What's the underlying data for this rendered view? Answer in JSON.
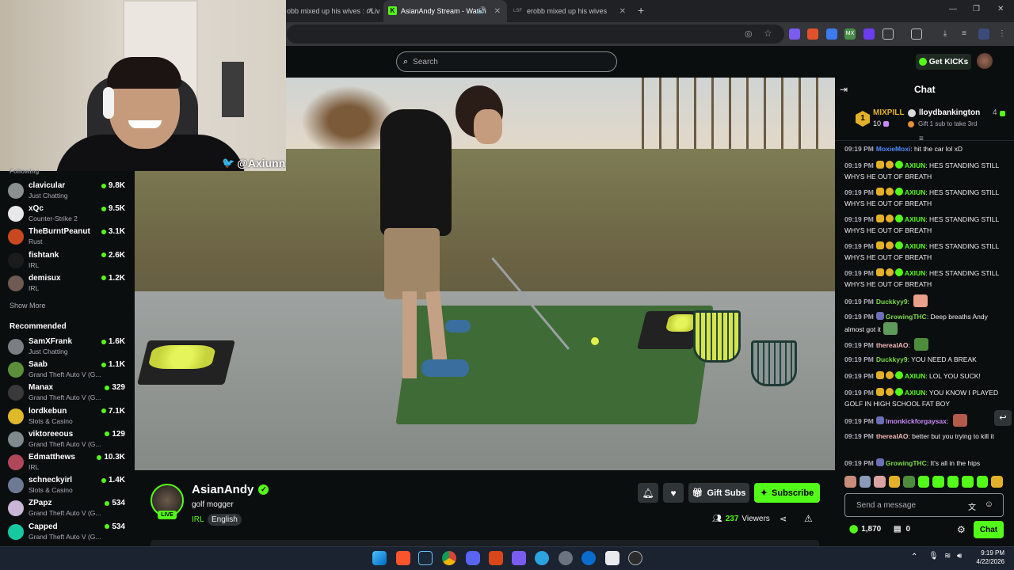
{
  "browser": {
    "tabs": [
      {
        "title": "obb mixed up his wives : r/Liv"
      },
      {
        "title": "AsianAndy Stream - Watch"
      },
      {
        "title": "erobb mixed up his wives",
        "prefix": "LSF"
      }
    ],
    "new_tab": "+",
    "window_min": "—",
    "window_restore": "❐",
    "window_close": "✕"
  },
  "header": {
    "search_placeholder": "Search",
    "get_kicks_label": "Get KICKs"
  },
  "webcam": {
    "twitter_handle": "@Axiunn"
  },
  "sidebar": {
    "following_heading": "Following",
    "following": [
      {
        "name": "clavicular",
        "category": "Just Chatting",
        "viewers": "9.8K",
        "color": "#8a8f8f"
      },
      {
        "name": "xQc",
        "category": "Counter-Strike 2",
        "viewers": "9.5K",
        "color": "#e8e8e8"
      },
      {
        "name": "TheBurntPeanut",
        "category": "Rust",
        "viewers": "3.1K",
        "color": "#c8491f"
      },
      {
        "name": "fishtank",
        "category": "IRL",
        "viewers": "2.6K",
        "color": "#1b1b1b"
      },
      {
        "name": "demisux",
        "category": "IRL",
        "viewers": "1.2K",
        "color": "#6e5a52"
      }
    ],
    "show_more": "Show More",
    "recommended_heading": "Recommended",
    "recommended": [
      {
        "name": "SamXFrank",
        "category": "Just Chatting",
        "viewers": "1.6K",
        "color": "#7b7e84"
      },
      {
        "name": "Saab",
        "category": "Grand Theft Auto V (G...",
        "viewers": "1.1K",
        "color": "#5b8f3a"
      },
      {
        "name": "Manax",
        "category": "Grand Theft Auto V (G...",
        "viewers": "329",
        "color": "#3a3a3a"
      },
      {
        "name": "lordkebun",
        "category": "Slots & Casino",
        "viewers": "7.1K",
        "color": "#e0b92b"
      },
      {
        "name": "viktoreeous",
        "category": "Grand Theft Auto V (G...",
        "viewers": "129",
        "color": "#7e8a8e"
      },
      {
        "name": "Edmatthews",
        "category": "IRL",
        "viewers": "10.3K",
        "color": "#b0485a"
      },
      {
        "name": "schneckyirl",
        "category": "Slots & Casino",
        "viewers": "1.4K",
        "color": "#6e7a94"
      },
      {
        "name": "ZPapz",
        "category": "Grand Theft Auto V (G...",
        "viewers": "534",
        "color": "#c9b6d6"
      },
      {
        "name": "Capped",
        "category": "Grand Theft Auto V (G...",
        "viewers": "534",
        "color": "#17c9a0"
      }
    ]
  },
  "stream": {
    "streamer": "AsianAndy",
    "title": "golf mogger",
    "category": "IRL",
    "language": "English",
    "live": "LIVE",
    "viewers": "237",
    "viewers_label": "Viewers",
    "gift_subs_label": "Gift Subs",
    "subscribe_label": "Subscribe"
  },
  "chat": {
    "title": "Chat",
    "pinned": {
      "left_name": "MIXPILL",
      "left_count": "10",
      "left_rank": "1",
      "right_name": "lloydbankington",
      "right_count": "4",
      "right_note": "Gift 1 sub to take 3rd"
    },
    "messages": [
      {
        "time": "09:19 PM",
        "user": "MoxieMoxi",
        "color": "#4f8bff",
        "text": "hit the car lol xD",
        "badges": []
      },
      {
        "time": "09:19 PM",
        "user": "AXIUN",
        "color": "#53fc18",
        "text": "HES STANDING STILL WHYS HE OUT OF BREATH",
        "badges": [
          "crown",
          "one",
          "ver"
        ]
      },
      {
        "time": "09:19 PM",
        "user": "AXIUN",
        "color": "#53fc18",
        "text": "HES STANDING STILL WHYS HE OUT OF BREATH",
        "badges": [
          "crown",
          "one",
          "ver"
        ]
      },
      {
        "time": "09:19 PM",
        "user": "AXIUN",
        "color": "#53fc18",
        "text": "HES STANDING STILL WHYS HE OUT OF BREATH",
        "badges": [
          "crown",
          "one",
          "ver"
        ]
      },
      {
        "time": "09:19 PM",
        "user": "AXIUN",
        "color": "#53fc18",
        "text": "HES STANDING STILL WHYS HE OUT OF BREATH",
        "badges": [
          "crown",
          "one",
          "ver"
        ]
      },
      {
        "time": "09:19 PM",
        "user": "AXIUN",
        "color": "#53fc18",
        "text": "HES STANDING STILL WHYS HE OUT OF BREATH",
        "badges": [
          "crown",
          "one",
          "ver"
        ]
      },
      {
        "time": "09:19 PM",
        "user": "Duckkyy9",
        "color": "#7bd84a",
        "text": "",
        "badges": [],
        "emote": "#e8a08a"
      },
      {
        "time": "09:19 PM",
        "user": "GrowingTHC",
        "color": "#7bd84a",
        "text": "Deep breaths Andy almost got it",
        "badges": [
          "sub"
        ],
        "emote": "#5e9a5a"
      },
      {
        "time": "09:19 PM",
        "user": "therealAO",
        "color": "#f6b8b8",
        "text": "",
        "badges": [],
        "emote": "#4d8c3b"
      },
      {
        "time": "09:19 PM",
        "user": "Duckkyy9",
        "color": "#7bd84a",
        "text": "YOU NEED A BREAK",
        "badges": []
      },
      {
        "time": "09:19 PM",
        "user": "AXIUN",
        "color": "#53fc18",
        "text": "LOL YOU SUCK!",
        "badges": [
          "crown",
          "one",
          "ver"
        ]
      },
      {
        "time": "09:19 PM",
        "user": "AXIUN",
        "color": "#53fc18",
        "text": "YOU KNOW I PLAYED GOLF IN HIGH SCHOOL FAT BOY",
        "badges": [
          "crown",
          "one",
          "ver"
        ]
      },
      {
        "time": "09:19 PM",
        "user": "lmonkickforgaysax",
        "color": "#c58af9",
        "text": "",
        "badges": [
          "sub"
        ],
        "emote": "#b35a4a"
      },
      {
        "time": "09:19 PM",
        "user": "therealAO",
        "color": "#f6b8b8",
        "text": "better but you trying to kill it",
        "badges": []
      },
      {
        "time": "09:19 PM",
        "user": "GrowingTHC",
        "color": "#7bd84a",
        "text": "It's all in the hips",
        "badges": [
          "sub"
        ]
      }
    ],
    "input_placeholder": "Send a message",
    "points": "1,870",
    "other_count": "0",
    "chat_button": "Chat"
  },
  "taskbar": {
    "time": "9:19 PM",
    "date": "4/22/2026"
  }
}
